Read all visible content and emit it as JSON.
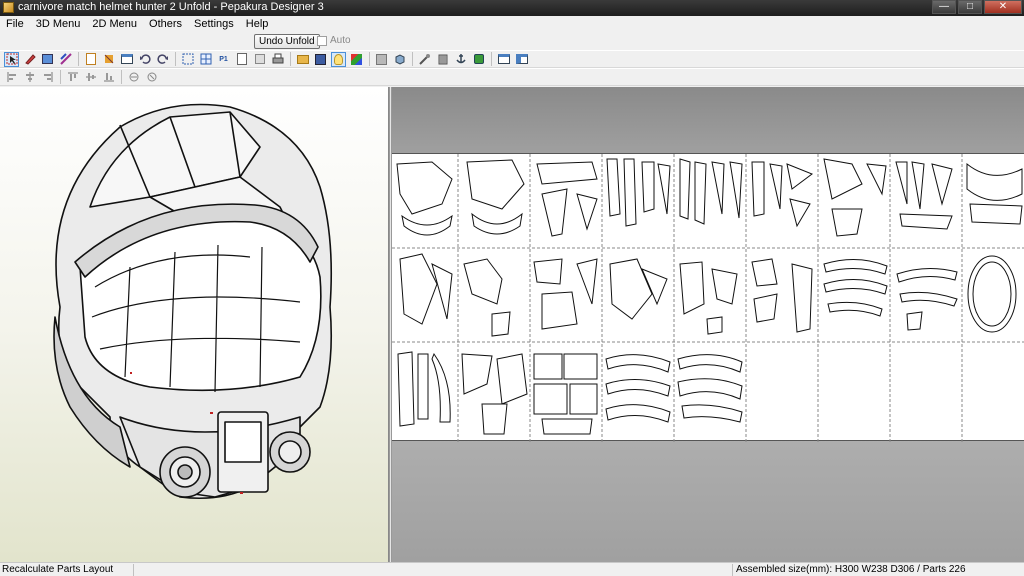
{
  "window": {
    "title": "carnivore match helmet hunter 2 Unfold - Pepakura Designer 3",
    "minimize_glyph": "—",
    "maximize_glyph": "□",
    "close_glyph": "✕"
  },
  "menu": {
    "items": [
      "File",
      "3D Menu",
      "2D Menu",
      "Others",
      "Settings",
      "Help"
    ]
  },
  "undo_bar": {
    "undo_label": "Undo Unfold",
    "auto_label": "Auto",
    "auto_checked": false
  },
  "toolbar1": {
    "icons": [
      "select-icon",
      "edit-icon",
      "unfold-icon",
      "edge-icon",
      "page-icon",
      "cut-icon",
      "flap-icon",
      "undo-icon",
      "redo-icon",
      "fit-icon",
      "grid-icon",
      "texture-icon",
      "print-preview-icon",
      "settings-icon",
      "print-icon",
      "open-icon",
      "save-icon",
      "light-icon",
      "color-cube-icon",
      "mesh-icon",
      "box-icon",
      "cylinder-icon",
      "anchor-icon",
      "join-icon",
      "window-single-icon",
      "window-split-icon"
    ],
    "text_glyphs": {
      "p1": "P1"
    },
    "active_icon": "light-icon"
  },
  "toolbar2": {
    "icons": [
      "align-left-icon",
      "align-center-icon",
      "align-right-icon",
      "align-top-icon",
      "align-middle-icon",
      "align-bottom-icon",
      "group-icon",
      "ungroup-icon"
    ]
  },
  "view_3d": {
    "model_name": "helmet",
    "background_top": "#ffffff",
    "background_bottom": "#e2e4cc"
  },
  "view_2d": {
    "grid_columns": 9,
    "grid_rows": 3,
    "filled_sheets_row3": 5
  },
  "status": {
    "left": "Recalculate Parts Layout",
    "right": "Assembled size(mm): H300 W238 D306 / Parts 226"
  }
}
